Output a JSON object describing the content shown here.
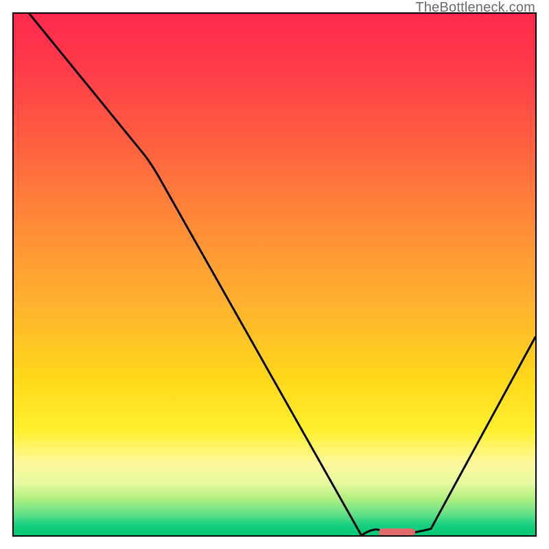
{
  "watermark": "TheBottleneck.com",
  "chart_data": {
    "type": "line",
    "title": "",
    "xlabel": "",
    "ylabel": "",
    "xlim": [
      0,
      100
    ],
    "ylim": [
      0,
      100
    ],
    "grid": false,
    "series": [
      {
        "name": "bottleneck-curve",
        "x": [
          3,
          25,
          68,
          74,
          80,
          100
        ],
        "y": [
          100,
          73,
          1,
          0,
          1,
          38
        ]
      }
    ],
    "marker": {
      "x_start": 70,
      "x_end": 77,
      "y": 0.7
    },
    "colors": {
      "curve": "#000000",
      "marker": "#e06a6a",
      "gradient_top": "#ff2a4d",
      "gradient_bottom": "#04c875"
    }
  }
}
